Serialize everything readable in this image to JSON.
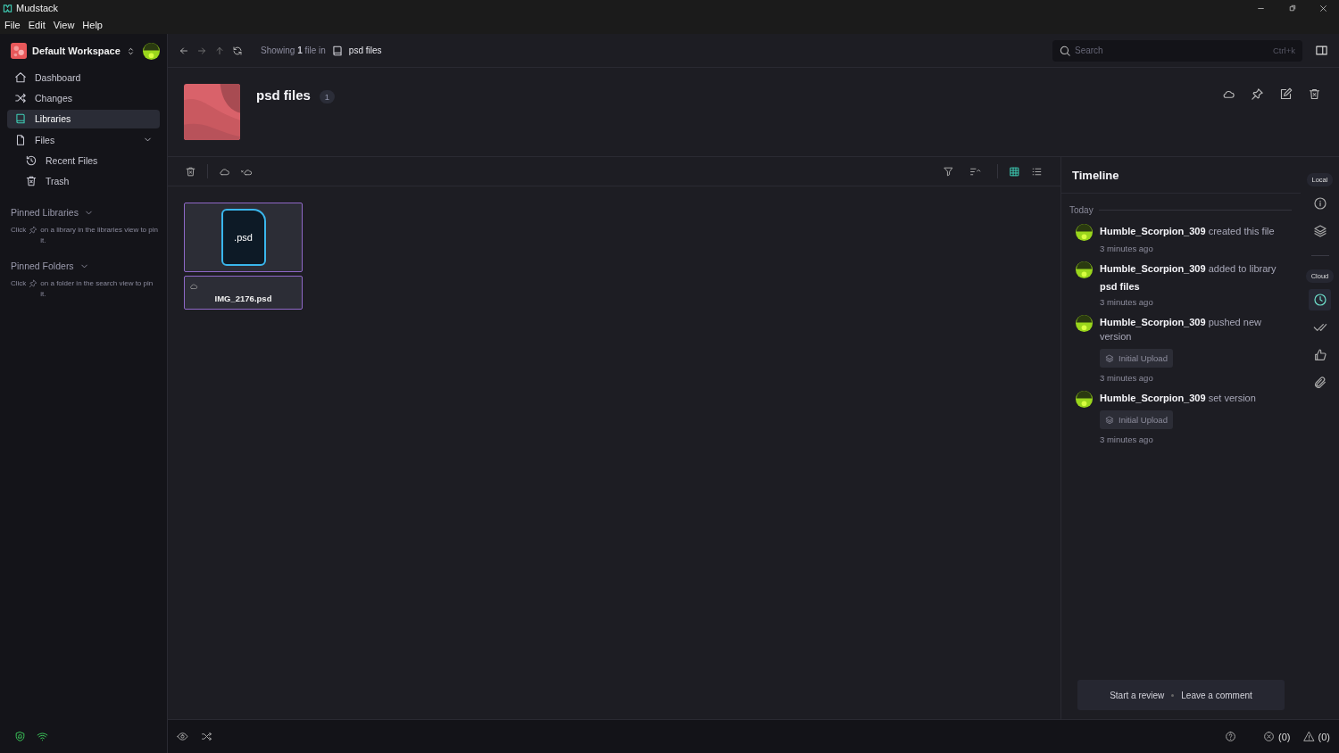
{
  "window": {
    "title": "Mudstack"
  },
  "menu": [
    "File",
    "Edit",
    "View",
    "Help"
  ],
  "sidebar": {
    "workspace": "Default Workspace",
    "items": [
      {
        "label": "Dashboard",
        "selected": false
      },
      {
        "label": "Changes",
        "selected": false
      },
      {
        "label": "Libraries",
        "selected": true
      },
      {
        "label": "Files",
        "selected": false,
        "expanded": true,
        "children": [
          {
            "label": "Recent Files",
            "selected": false
          },
          {
            "label": "Trash",
            "selected": false
          }
        ]
      }
    ],
    "sections": [
      {
        "title": "Pinned Libraries",
        "hint_before": "Click",
        "hint_after": "on a library in the libraries view to pin it."
      },
      {
        "title": "Pinned Folders",
        "hint_before": "Click",
        "hint_after": "on a folder in the search view to pin it."
      }
    ]
  },
  "breadcrumb": {
    "text": "Showing **1** file in",
    "library": "psd files"
  },
  "search": {
    "placeholder": "Search",
    "shortcut": "Ctrl+k"
  },
  "library": {
    "title": "psd files",
    "count": "1"
  },
  "view_modes": [
    {
      "selected": true
    },
    {
      "selected": false
    }
  ],
  "files": [
    {
      "extension": ".psd",
      "name": "IMG_2176.psd",
      "selected": true
    }
  ],
  "timeline": {
    "title": "Timeline",
    "group": "Today",
    "events": [
      {
        "text": "**Humble_Scorpion_309** created this file",
        "time": "3 minutes ago"
      },
      {
        "text": "**Humble_Scorpion_309** added to library",
        "library": "psd files",
        "time": "3 minutes ago"
      },
      {
        "text": "**Humble_Scorpion_309** pushed new version",
        "version": "Initial Upload",
        "time": "3 minutes ago"
      },
      {
        "text": "**Humble_Scorpion_309** set version",
        "version": "Initial Upload",
        "time": "3 minutes ago"
      }
    ],
    "actions": [
      "Start a review",
      "Leave a comment"
    ]
  },
  "rail": [
    {
      "label": "Local",
      "items": [
        {
          "selected": false
        },
        {
          "selected": false
        }
      ]
    },
    {
      "label": "Cloud",
      "items": [
        {
          "selected": true
        },
        {
          "selected": false
        },
        {
          "selected": false
        },
        {
          "selected": false
        }
      ]
    }
  ],
  "status": {
    "errors": "(0)",
    "warnings": "(0)"
  }
}
